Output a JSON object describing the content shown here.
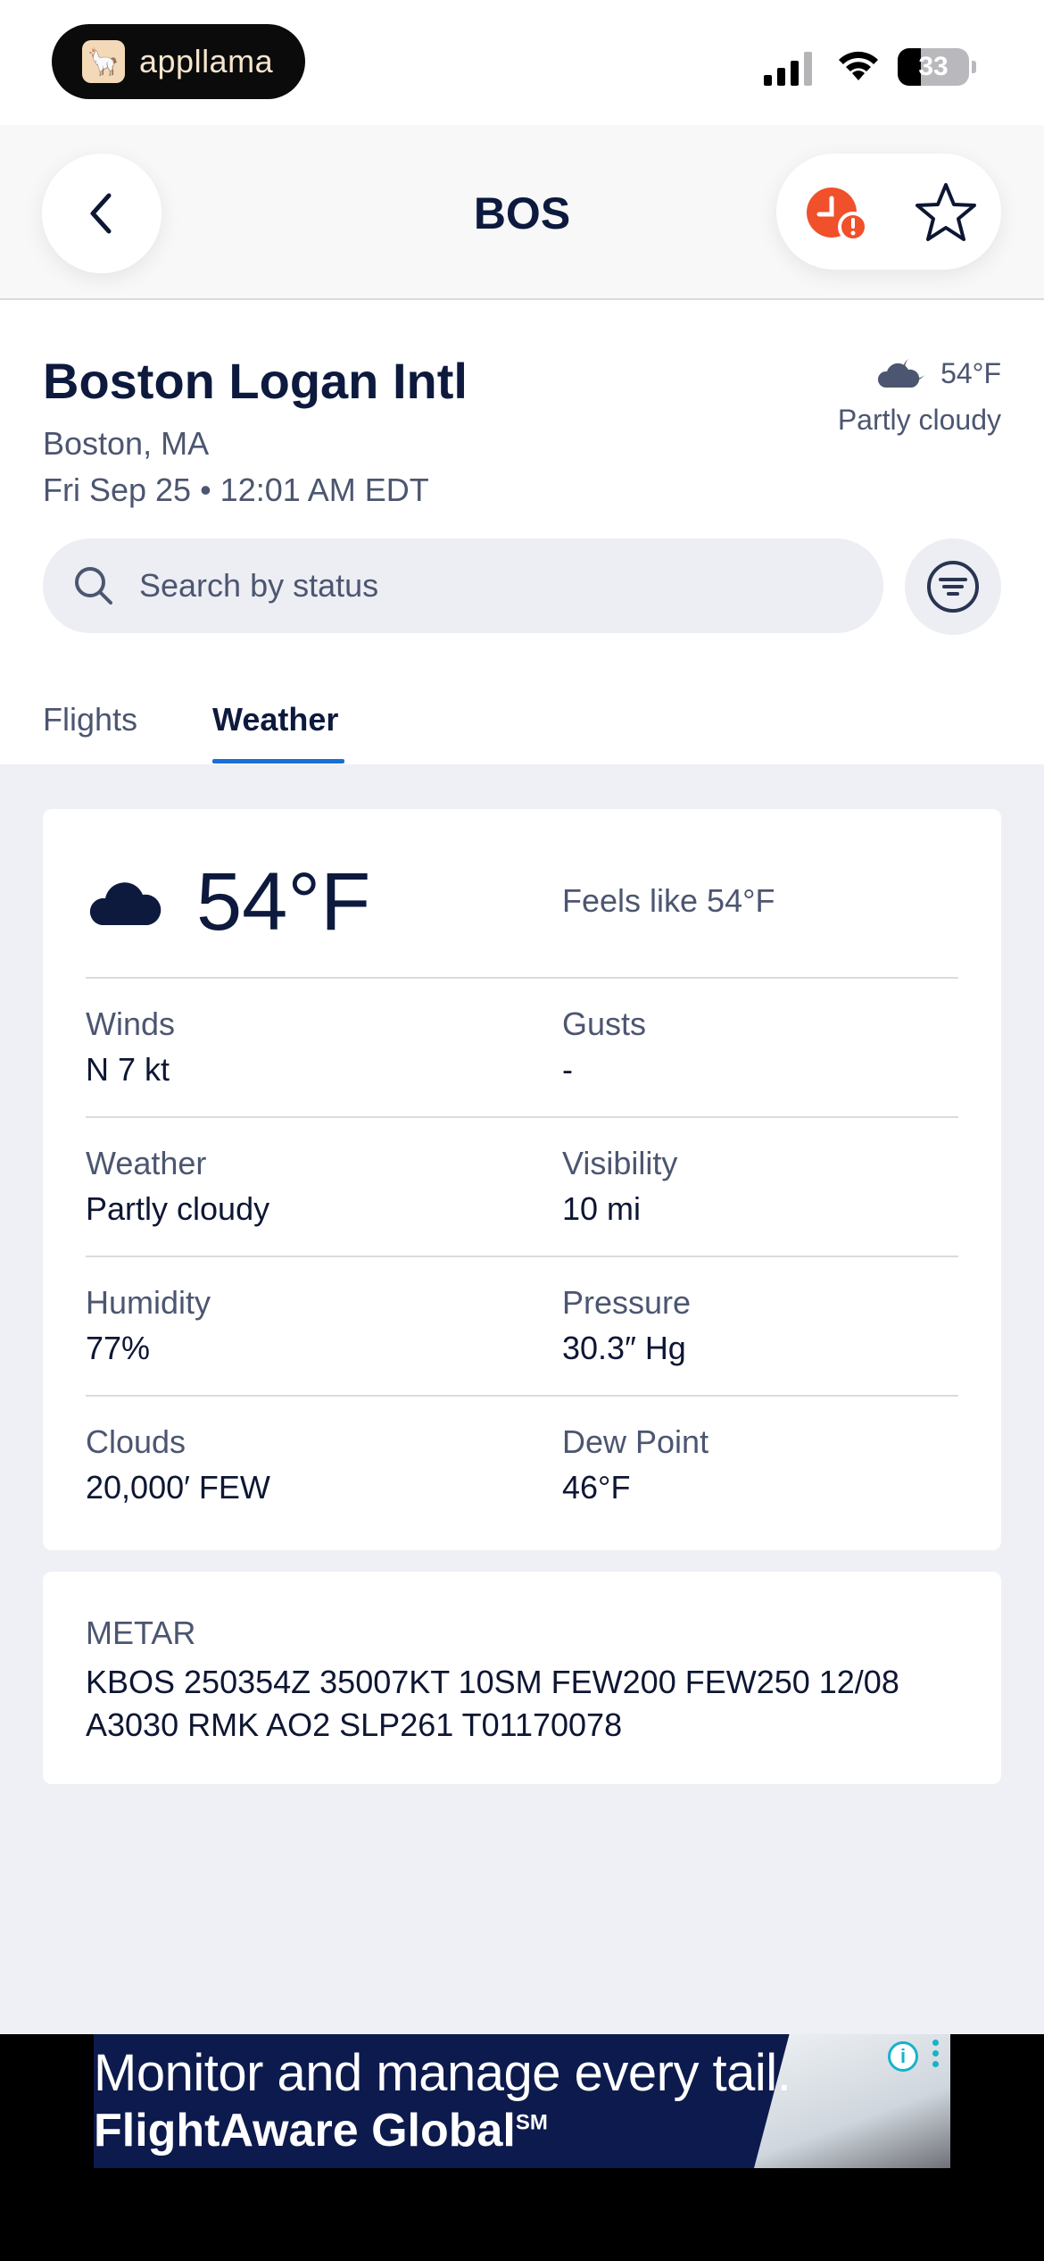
{
  "status_bar": {
    "app_pill_label": "appllama",
    "battery_level": "33",
    "battery_fraction": 0.33
  },
  "header": {
    "title": "BOS"
  },
  "airport": {
    "name": "Boston Logan Intl",
    "location": "Boston, MA",
    "datetime": "Fri Sep 25 • 12:01 AM EDT",
    "temp": "54°F",
    "condition": "Partly cloudy"
  },
  "search": {
    "placeholder": "Search by status"
  },
  "tabs": [
    {
      "label": "Flights",
      "active": false
    },
    {
      "label": "Weather",
      "active": true
    }
  ],
  "weather": {
    "temp": "54°F",
    "feels_like": "Feels like 54°F",
    "rows": [
      {
        "left_label": "Winds",
        "left_value": "N 7 kt",
        "right_label": "Gusts",
        "right_value": "-"
      },
      {
        "left_label": "Weather",
        "left_value": "Partly cloudy",
        "right_label": "Visibility",
        "right_value": "10 mi"
      },
      {
        "left_label": "Humidity",
        "left_value": "77%",
        "right_label": "Pressure",
        "right_value": "30.3″ Hg"
      },
      {
        "left_label": "Clouds",
        "left_value": "20,000′ FEW",
        "right_label": "Dew Point",
        "right_value": "46°F"
      }
    ]
  },
  "metar": {
    "label": "METAR",
    "text": "KBOS 250354Z 35007KT 10SM FEW200 FEW250 12/08 A3030 RMK AO2 SLP261 T01170078"
  },
  "ad": {
    "line1": "Monitor and manage every tail.",
    "line2": "FlightAware Global",
    "line2_mark": "SM",
    "info_glyph": "i"
  },
  "colors": {
    "accent": "#1b6ed6",
    "alert": "#f0502a",
    "navy": "#0d1a3e"
  },
  "icons": [
    "back-chevron-icon",
    "clock-alert-icon",
    "star-icon",
    "partly-cloudy-night-icon",
    "search-icon",
    "filter-icon",
    "info-icon",
    "ad-menu-icon"
  ]
}
